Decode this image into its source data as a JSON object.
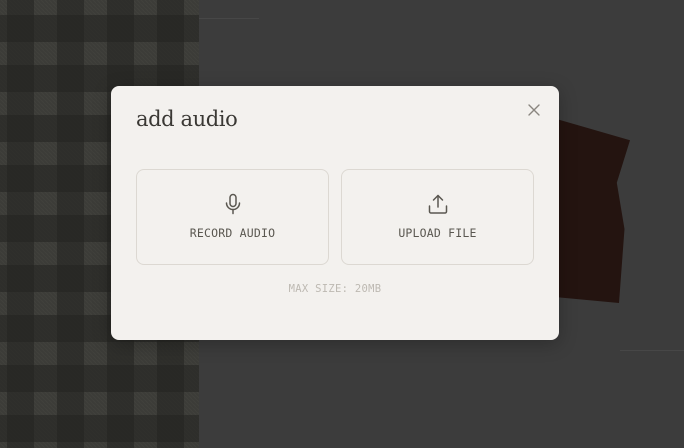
{
  "modal": {
    "title": "add audio",
    "close_icon": "close-icon",
    "options": [
      {
        "label": "RECORD AUDIO",
        "icon": "microphone-icon"
      },
      {
        "label": "UPLOAD FILE",
        "icon": "upload-icon"
      }
    ],
    "max_size_text": "MAX SIZE: 20MB"
  },
  "colors": {
    "modal_bg": "#f3f1ee",
    "backdrop": "#3c3c3c",
    "title_text": "#3a3834",
    "option_border": "#dcd8d2",
    "hint_text": "#bdb9b2"
  }
}
